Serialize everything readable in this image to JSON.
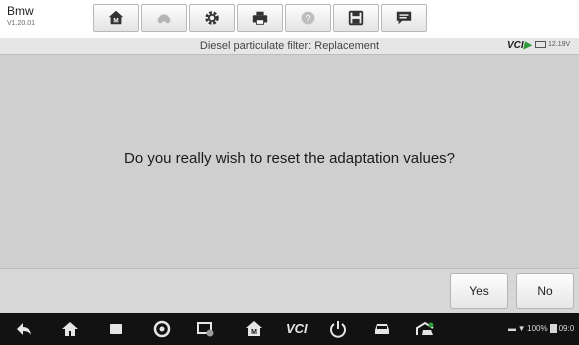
{
  "header": {
    "brand": "Bmw",
    "version": "V1.20.01",
    "toolbar": [
      {
        "icon": "home-icon"
      },
      {
        "icon": "vehicle-swap-icon"
      },
      {
        "icon": "settings-icon"
      },
      {
        "icon": "print-icon"
      },
      {
        "icon": "help-icon"
      },
      {
        "icon": "save-icon"
      },
      {
        "icon": "data-logging-icon"
      }
    ]
  },
  "subheader": {
    "title": "Diesel particulate filter: Replacement",
    "vci_label": "VCI",
    "voltage": "12.19V"
  },
  "dialog": {
    "message": "Do you really wish to reset the adaptation values?"
  },
  "footer": {
    "yes_label": "Yes",
    "no_label": "No"
  },
  "navbar": {
    "vci_label": "VCI",
    "battery": "100%",
    "time": "09:0"
  },
  "colors": {
    "accent_green": "#2e9c3f",
    "background": "#cfcfcf",
    "navbar": "#121212"
  }
}
